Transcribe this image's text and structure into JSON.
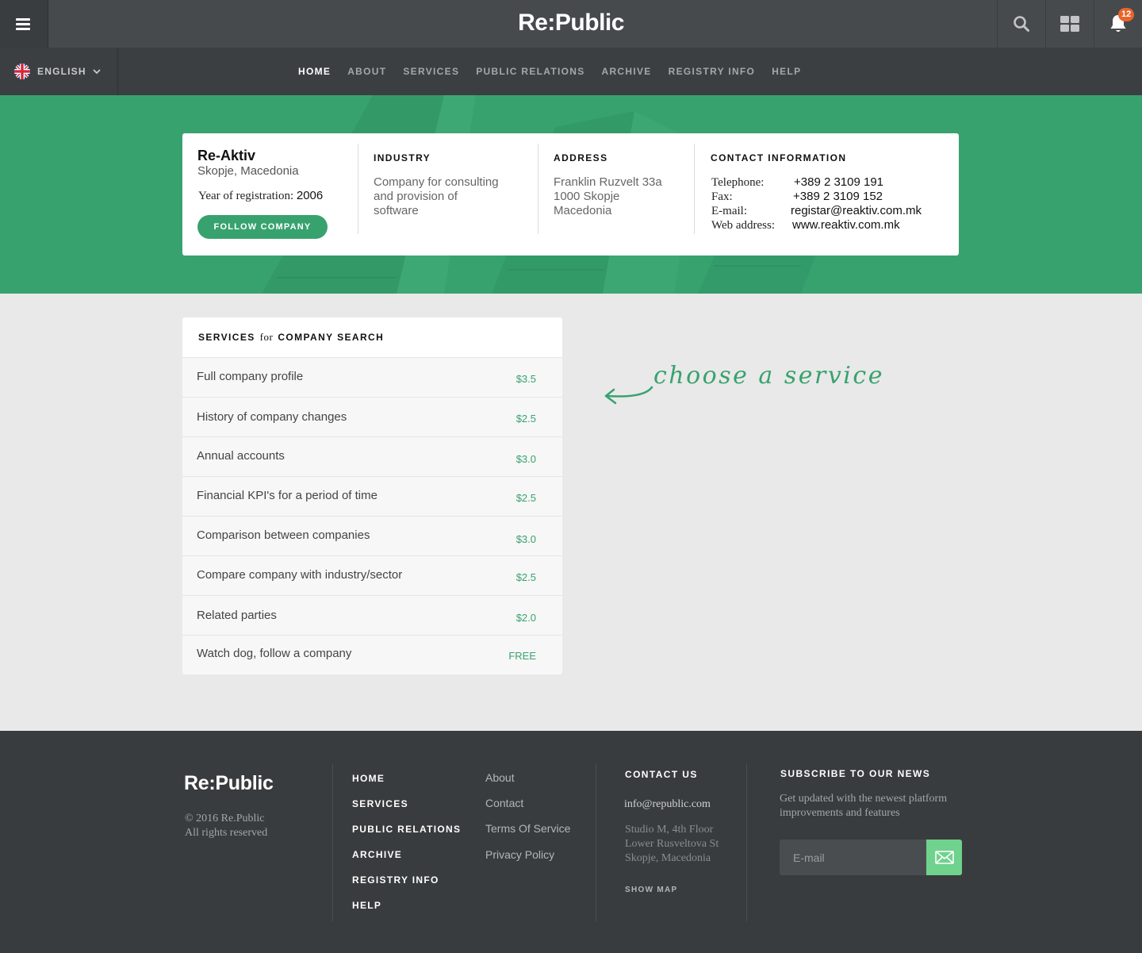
{
  "header": {
    "logo": "Re:Public",
    "notification_count": "12"
  },
  "nav": {
    "language": "ENGLISH",
    "links": [
      "HOME",
      "ABOUT",
      "SERVICES",
      "PUBLIC RELATIONS",
      "ARCHIVE",
      "REGISTRY INFO",
      "HELP"
    ],
    "active": "HOME"
  },
  "company": {
    "name": "Re-Aktiv",
    "location": "Skopje, Macedonia",
    "year_label": "Year of registration:",
    "year": "2006",
    "follow_label": "FOLLOW COMPANY",
    "industry_heading": "INDUSTRY",
    "industry_lines": [
      "Company for consulting",
      "and provision of",
      "software"
    ],
    "address_heading": "ADDRESS",
    "address_lines": [
      "Franklin Ruzvelt 33a",
      "1000 Skopje",
      "Macedonia"
    ],
    "contact_heading": "CONTACT INFORMATION",
    "contact": [
      {
        "label": "Telephone:",
        "value": "+389 2 3109 191"
      },
      {
        "label": "Fax:",
        "value": "+389 2 3109 152"
      },
      {
        "label": "E-mail:",
        "value": "registar@reaktiv.com.mk"
      },
      {
        "label": "Web address:",
        "value": "www.reaktiv.com.mk"
      }
    ]
  },
  "services": {
    "heading_pre": "SERVICES",
    "heading_for": "for",
    "heading_post": "COMPANY SEARCH",
    "items": [
      {
        "name": "Full company profile",
        "price": "$3.5"
      },
      {
        "name": "History of company changes",
        "price": "$2.5"
      },
      {
        "name": "Annual accounts",
        "price": "$3.0"
      },
      {
        "name": "Financial KPI's for a period of time",
        "price": "$2.5"
      },
      {
        "name": "Comparison between companies",
        "price": "$3.0"
      },
      {
        "name": "Compare company with industry/sector",
        "price": "$2.5"
      },
      {
        "name": "Related parties",
        "price": "$2.0"
      },
      {
        "name": "Watch dog, follow a company",
        "price": "FREE"
      }
    ]
  },
  "callout": "choose a service",
  "footer": {
    "logo": "Re:Public",
    "copyright_lines": [
      "© 2016 Re.Public",
      "All rights reserved"
    ],
    "main_links": [
      "HOME",
      "SERVICES",
      "PUBLIC RELATIONS",
      "ARCHIVE",
      "REGISTRY INFO",
      "HELP"
    ],
    "secondary_links": [
      "About",
      "Contact",
      "Terms Of Service",
      "Privacy Policy"
    ],
    "contact_heading": "CONTACT US",
    "contact_email": "info@republic.com",
    "address_lines": [
      "Studio M, 4th Floor",
      "Lower Rusveltova St",
      "Skopje, Macedonia"
    ],
    "show_map": "SHOW MAP",
    "subscribe_heading": "SUBSCRIBE TO OUR NEWS",
    "subscribe_desc": "Get updated with the newest platform improvements and features",
    "email_placeholder": "E-mail"
  },
  "colors": {
    "accent": "#38a26e",
    "topbar": "#474a4d",
    "navbar": "#3c3f42",
    "footer": "#393c3e",
    "badge": "#e8642a",
    "send_button": "#6fd28d"
  }
}
